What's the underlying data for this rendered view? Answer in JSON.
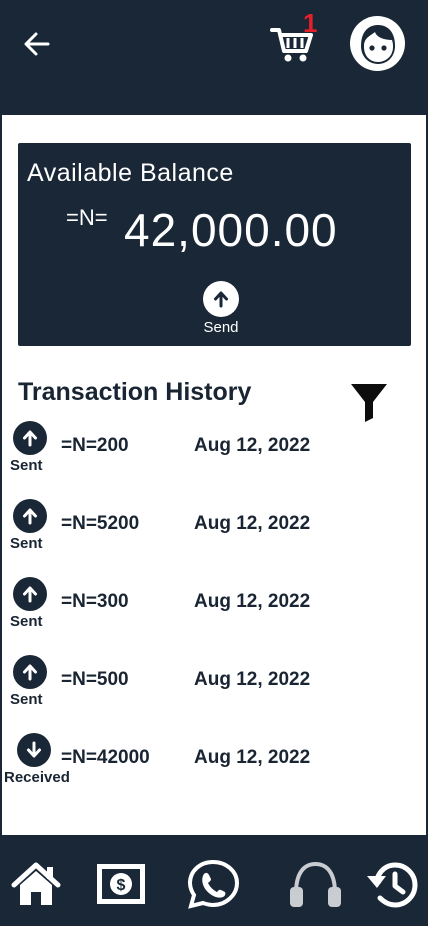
{
  "header": {
    "cart_count": "1"
  },
  "balance": {
    "label": "Available Balance",
    "currency": "=N=",
    "amount": "42,000.00",
    "send_label": "Send"
  },
  "history": {
    "title": "Transaction History",
    "transactions": [
      {
        "type": "Sent",
        "amount": "=N=200",
        "date": "Aug 12, 2022",
        "direction": "up"
      },
      {
        "type": "Sent",
        "amount": "=N=5200",
        "date": "Aug 12, 2022",
        "direction": "up"
      },
      {
        "type": "Sent",
        "amount": "=N=300",
        "date": "Aug 12, 2022",
        "direction": "up"
      },
      {
        "type": "Sent",
        "amount": "=N=500",
        "date": "Aug 12, 2022",
        "direction": "up"
      },
      {
        "type": "Received",
        "amount": "=N=42000",
        "date": "Aug 12, 2022",
        "direction": "down"
      }
    ]
  },
  "nav": {
    "items": [
      "home-icon",
      "money-icon",
      "whatsapp-icon",
      "headphones-icon",
      "history-icon"
    ]
  },
  "colors": {
    "primary": "#192736",
    "badge": "#e3202a",
    "background": "#ffffff"
  }
}
